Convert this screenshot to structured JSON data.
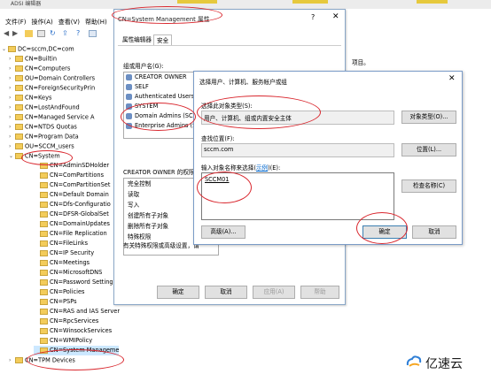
{
  "adsi": {
    "title": "ADSI 编辑器",
    "menu": [
      "文件(F)",
      "操作(A)",
      "查看(V)",
      "帮助(H)"
    ],
    "tree": [
      {
        "label": "DC=sccm,DC=com",
        "depth": 0,
        "expanded": true
      },
      {
        "label": "CN=Builtin",
        "depth": 1
      },
      {
        "label": "CN=Computers",
        "depth": 1
      },
      {
        "label": "OU=Domain Controllers",
        "depth": 1
      },
      {
        "label": "CN=ForeignSecurityPrin",
        "depth": 1
      },
      {
        "label": "CN=Keys",
        "depth": 1
      },
      {
        "label": "CN=LostAndFound",
        "depth": 1
      },
      {
        "label": "CN=Managed Service A",
        "depth": 1
      },
      {
        "label": "CN=NTDS Quotas",
        "depth": 1
      },
      {
        "label": "CN=Program Data",
        "depth": 1
      },
      {
        "label": "OU=SCCM_users",
        "depth": 1
      },
      {
        "label": "CN=System",
        "depth": 1,
        "expanded": true
      },
      {
        "label": "CN=AdminSDHolder",
        "depth": 2
      },
      {
        "label": "CN=ComPartitions",
        "depth": 2
      },
      {
        "label": "CN=ComPartitionSet",
        "depth": 2
      },
      {
        "label": "CN=Default Domain",
        "depth": 2
      },
      {
        "label": "CN=Dfs-Configuratio",
        "depth": 2
      },
      {
        "label": "CN=DFSR-GlobalSet",
        "depth": 2
      },
      {
        "label": "CN=DomainUpdates",
        "depth": 2
      },
      {
        "label": "CN=File Replication",
        "depth": 2
      },
      {
        "label": "CN=FileLinks",
        "depth": 2
      },
      {
        "label": "CN=IP Security",
        "depth": 2
      },
      {
        "label": "CN=Meetings",
        "depth": 2
      },
      {
        "label": "CN=MicrosoftDNS",
        "depth": 2
      },
      {
        "label": "CN=Password Setting",
        "depth": 2
      },
      {
        "label": "CN=Policies",
        "depth": 2
      },
      {
        "label": "CN=PSPs",
        "depth": 2
      },
      {
        "label": "CN=RAS and IAS Server",
        "depth": 2
      },
      {
        "label": "CN=RpcServices",
        "depth": 2
      },
      {
        "label": "CN=WinsockServices",
        "depth": 2
      },
      {
        "label": "CN=WMIPolicy",
        "depth": 2
      },
      {
        "label": "CN=System Manageme",
        "depth": 2,
        "selected": true
      },
      {
        "label": "CN=TPM Devices",
        "depth": 1
      }
    ],
    "right_text": "项目。"
  },
  "properties": {
    "title": "CN=System Management 属性",
    "help": "?",
    "close": "✕",
    "tabs": [
      "属性编辑器",
      "安全"
    ],
    "groups_label": "组或用户名(G):",
    "users": [
      "CREATOR OWNER",
      "SELF",
      "Authenticated Users",
      "SYSTEM",
      "Domain Admins (SCC",
      "Enterprise Admins (S"
    ],
    "perm_label": "CREATOR OWNER 的权限",
    "perms": [
      "完全控制",
      "读取",
      "写入",
      "创建所有子对象",
      "删除所有子对象",
      "特殊权限"
    ],
    "special_note": "有关特殊权限或高级设置，请",
    "buttons": {
      "ok": "确定",
      "cancel": "取消",
      "apply": "应用(A)",
      "help": "帮助"
    }
  },
  "select_dialog": {
    "title": "选择用户、计算机、服务帐户或组",
    "close": "✕",
    "type_label": "选择此对象类型(S):",
    "type_value": "用户、计算机、组或内置安全主体",
    "type_button": "对象类型(O)...",
    "location_label": "查找位置(F):",
    "location_value": "sccm.com",
    "location_button": "位置(L)...",
    "names_label_prefix": "输入对象名称来选择(",
    "names_label_link": "示例",
    "names_label_suffix": ")(E):",
    "names_value": "SCCM01",
    "check_button": "检查名称(C)",
    "advanced_button": "高级(A)...",
    "ok": "确定",
    "cancel": "取消"
  },
  "watermark": "亿速云",
  "colors": {
    "annotation": "#d9272e",
    "accent": "#0066cc"
  }
}
